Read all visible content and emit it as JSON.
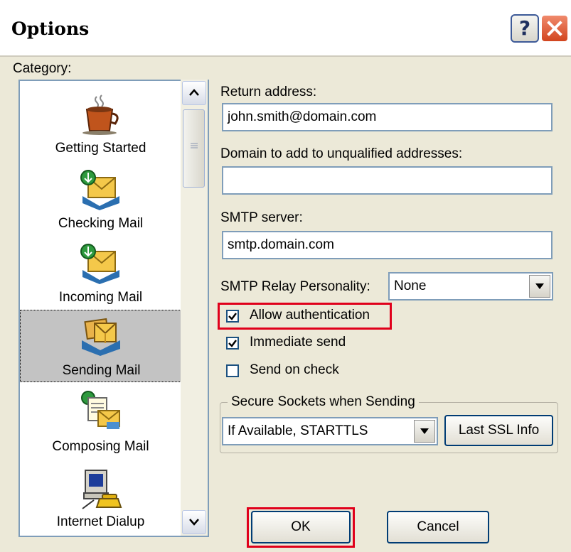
{
  "window": {
    "title": "Options",
    "help_glyph": "?",
    "close_icon": "close-icon"
  },
  "category": {
    "label": "Category:",
    "items": [
      {
        "label": "Getting Started",
        "icon": "coffee-cup-icon"
      },
      {
        "label": "Checking Mail",
        "icon": "envelope-download-icon"
      },
      {
        "label": "Incoming Mail",
        "icon": "envelope-download-icon"
      },
      {
        "label": "Sending Mail",
        "icon": "outbox-envelopes-icon",
        "selected": true
      },
      {
        "label": "Composing Mail",
        "icon": "compose-document-icon"
      },
      {
        "label": "Internet Dialup",
        "icon": "computer-phone-icon"
      }
    ]
  },
  "form": {
    "return_address_label": "Return address:",
    "return_address_value": "john.smith@domain.com",
    "domain_label": "Domain to add to unqualified addresses:",
    "domain_value": "",
    "smtp_server_label": "SMTP server:",
    "smtp_server_value": "smtp.domain.com",
    "relay_label": "SMTP Relay Personality:",
    "relay_value": "None",
    "checkboxes": [
      {
        "label": "Allow authentication",
        "checked": true
      },
      {
        "label": "Immediate send",
        "checked": true
      },
      {
        "label": "Send on check",
        "checked": false
      }
    ],
    "ssl_group_label": "Secure Sockets when Sending",
    "ssl_value": "If Available, STARTTLS",
    "last_ssl_button": "Last SSL Info"
  },
  "buttons": {
    "ok": "OK",
    "cancel": "Cancel"
  },
  "colors": {
    "dialog_bg": "#ece9d8",
    "highlight": "#e0001b",
    "selected_item_bg": "#c3c3c3"
  }
}
